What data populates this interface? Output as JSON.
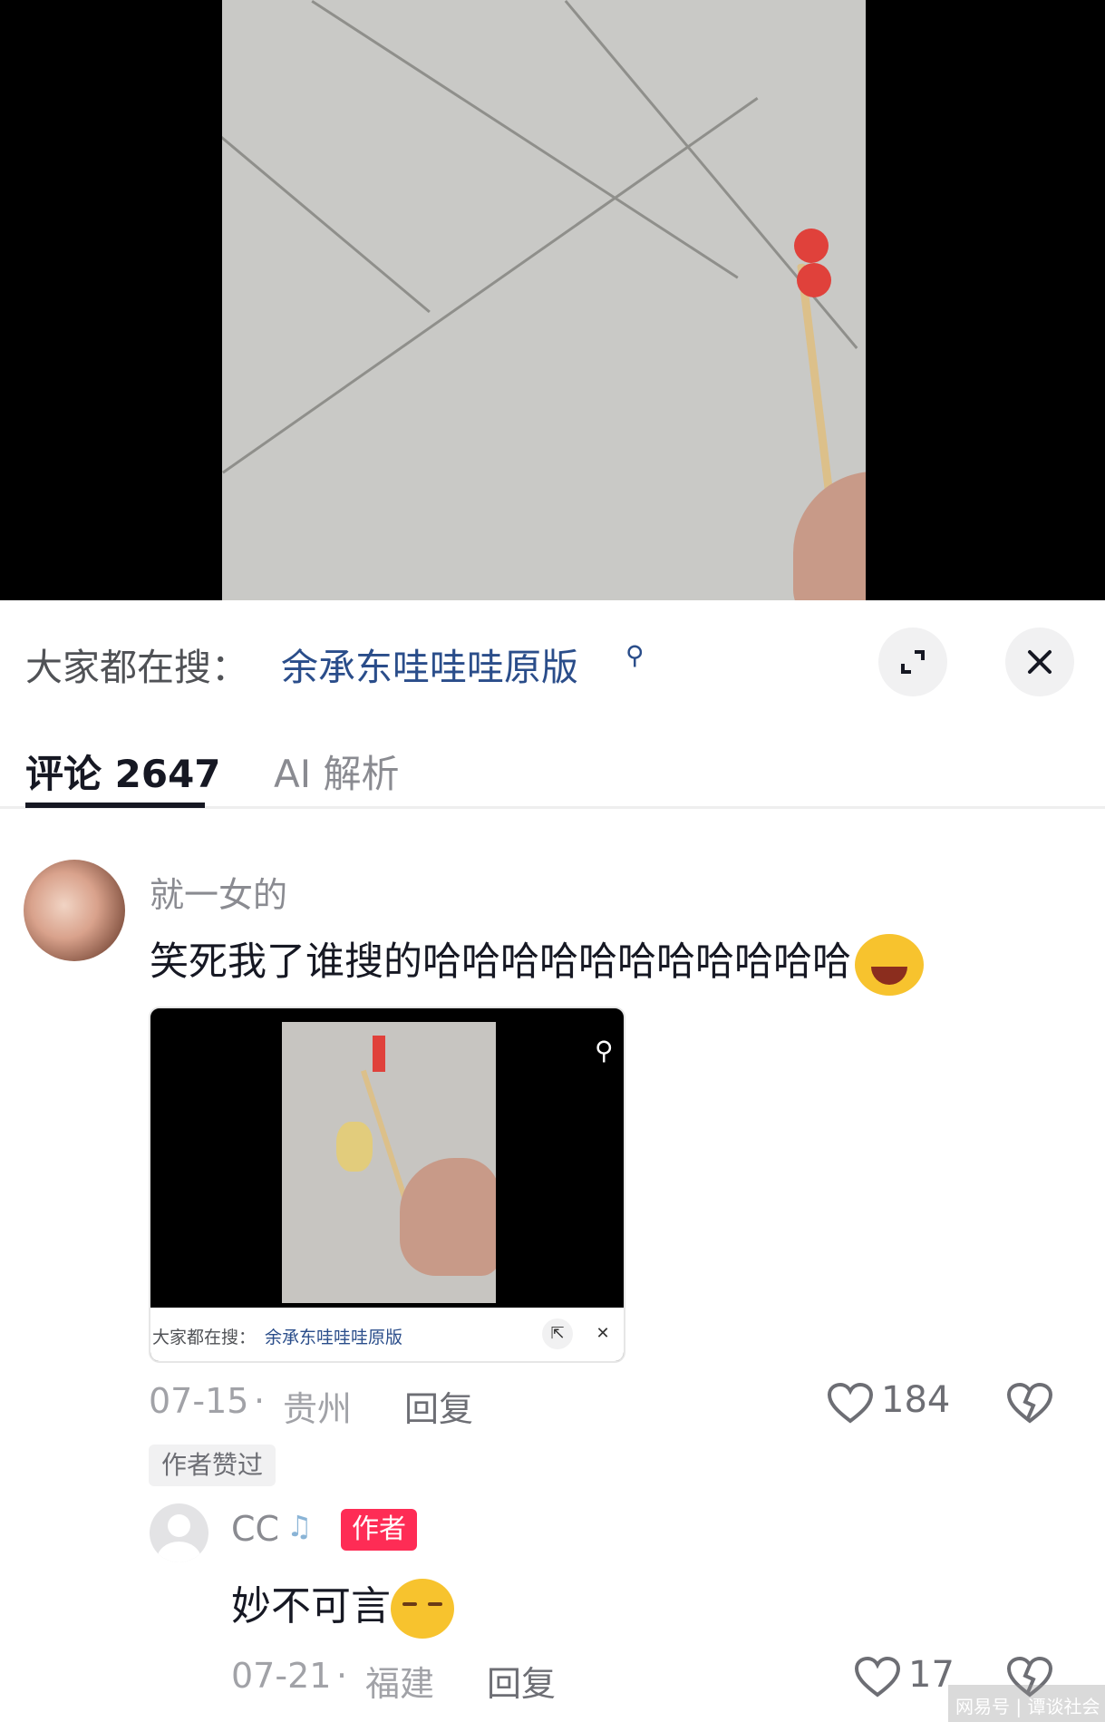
{
  "search_bar": {
    "prefix": "大家都在搜：",
    "query": "余承东哇哇哇原版",
    "search_icon": "magnifier-icon",
    "expand_icon": "expand-icon",
    "close_icon": "close-icon"
  },
  "tabs": [
    {
      "label": "评论 2647",
      "active": true
    },
    {
      "label": "AI 解析",
      "active": false
    }
  ],
  "comment": {
    "username": "就一女的",
    "text": "笑死我了谁搜的哈哈哈哈哈哈哈哈哈哈哈",
    "emoji": "laughing-tears-emoji",
    "embedded_screenshot": {
      "prefix": "大家都在搜：",
      "query": "余承东哇哇哇原版"
    },
    "date": "07-15",
    "location": "贵州",
    "reply_label": "回复",
    "likes": "184",
    "author_liked_label": "作者赞过"
  },
  "reply": {
    "username": "CC",
    "author_tag": "作者",
    "text": "妙不可言",
    "emoji": "smiling-closed-eyes-emoji",
    "date": "07-21",
    "location": "福建",
    "reply_label": "回复",
    "likes": "17"
  },
  "watermark": "网易号 | 谭谈社会",
  "colors": {
    "link": "#2a4d8a",
    "author_tag": "#fe2c55",
    "muted_text": "#8a8b91"
  }
}
